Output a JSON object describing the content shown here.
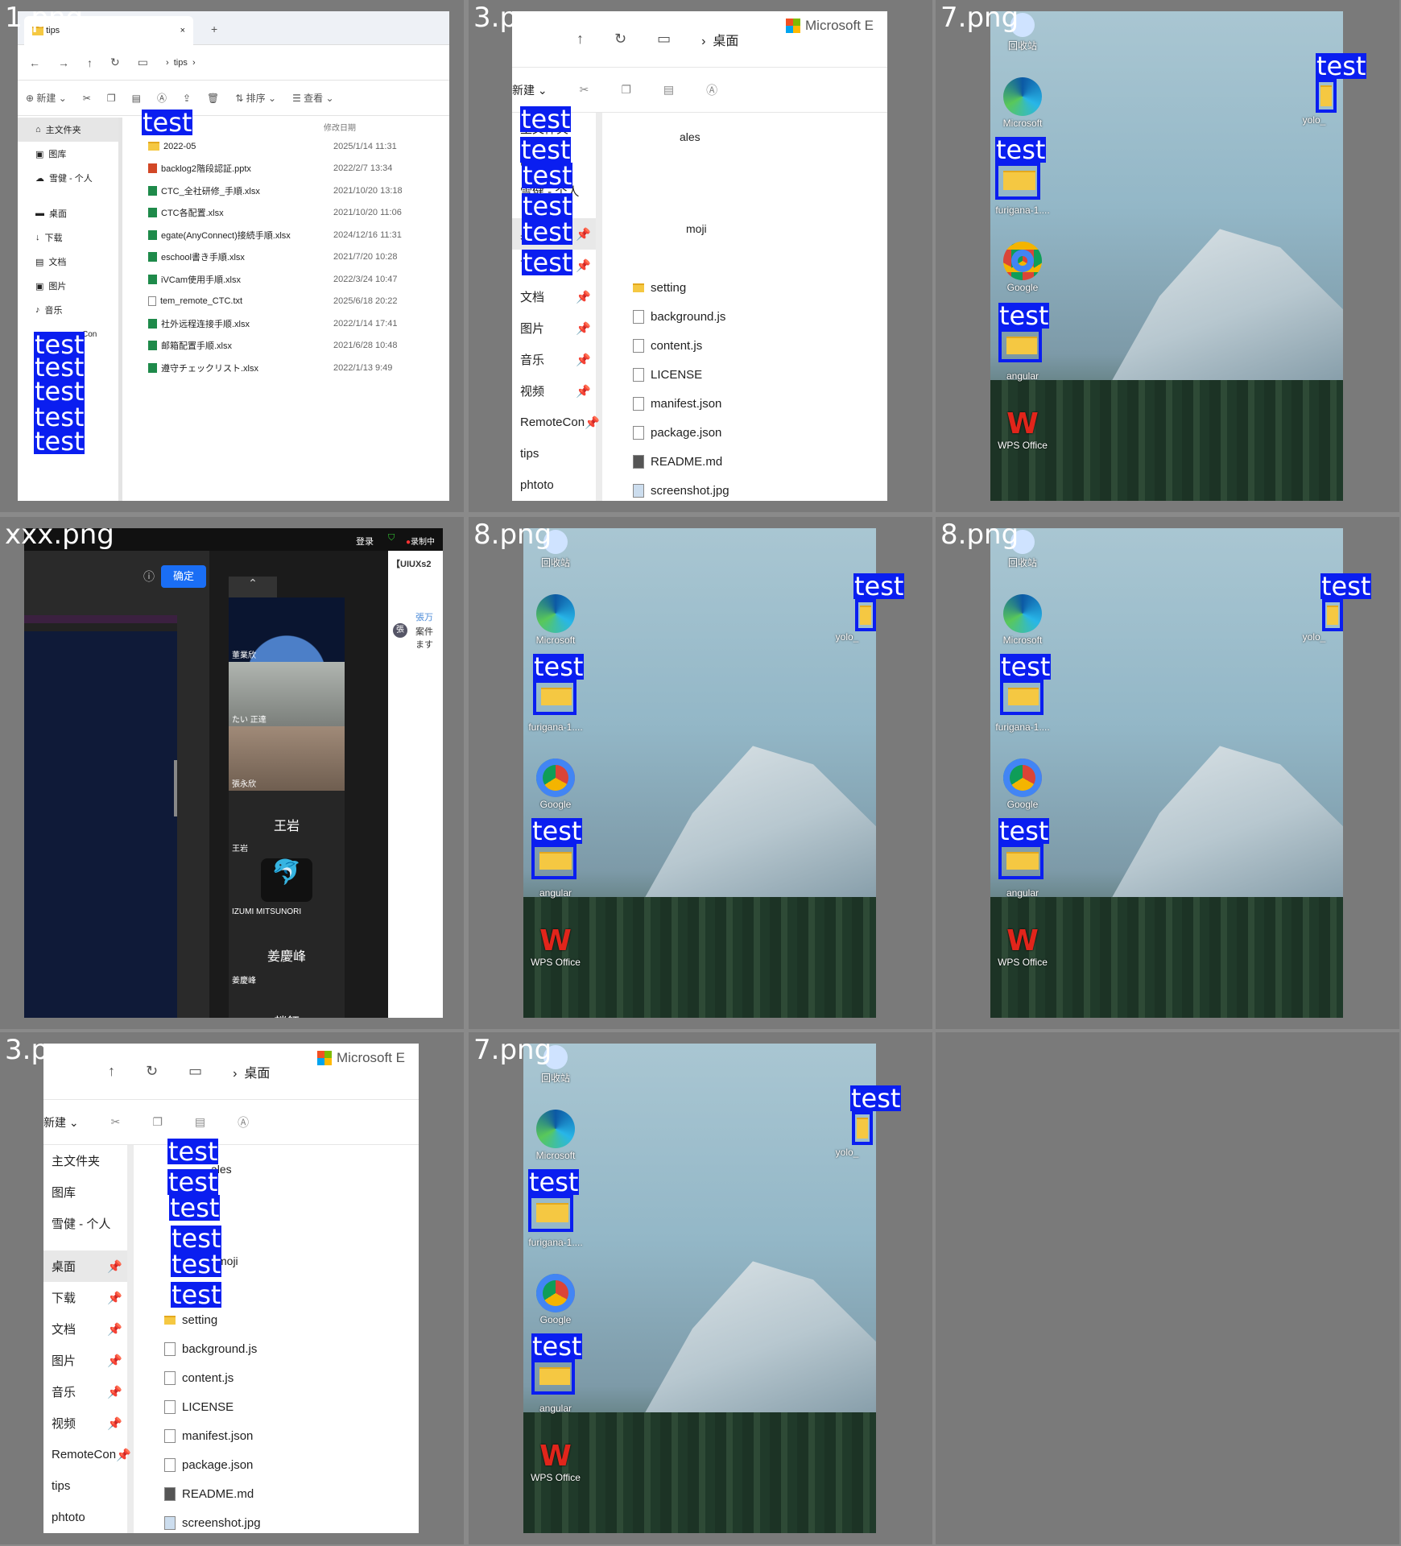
{
  "tiles": {
    "t1": {
      "label": "1.png"
    },
    "t2": {
      "label": "3.png"
    },
    "t3": {
      "label": "7.png"
    },
    "t4": {
      "label": "xxx.png"
    },
    "t5": {
      "label": "8.png"
    },
    "t6": {
      "label": "8.png"
    },
    "t7": {
      "label": "3.png"
    },
    "t8": {
      "label": "7.png"
    }
  },
  "det": {
    "text": "test"
  },
  "explorer1": {
    "tab": "tips",
    "path": "tips",
    "cmd_new": "新建",
    "cmd_sort": "排序",
    "cmd_view": "查看",
    "col_date": "修改日期",
    "side": [
      "主文件夹",
      "图库",
      "雪健 - 个人",
      "桌面",
      "下载",
      "文档",
      "图片",
      "音乐"
    ],
    "side_partial": "Con",
    "side_last": "val",
    "files": [
      {
        "name": "2022-05",
        "date": "2025/1/14 11:31"
      },
      {
        "name": "backlog2階段認証.pptx",
        "date": "2022/2/7 13:34"
      },
      {
        "name": "CTC_全社研修_手順.xlsx",
        "date": "2021/10/20 13:18"
      },
      {
        "name": "CTC各配置.xlsx",
        "date": "2021/10/20 11:06"
      },
      {
        "name": "egate(AnyConnect)接続手順.xlsx",
        "date": "2024/12/16 11:31"
      },
      {
        "name": "eschool書き手順.xlsx",
        "date": "2021/7/20 10:28"
      },
      {
        "name": "iVCam使用手順.xlsx",
        "date": "2022/3/24 10:47"
      },
      {
        "name": "tem_remote_CTC.txt",
        "date": "2025/6/18 20:22"
      },
      {
        "name": "社外远程连接手顺.xlsx",
        "date": "2022/1/14 17:41"
      },
      {
        "name": "邮箱配置手顺.xlsx",
        "date": "2021/6/28 10:48"
      },
      {
        "name": "遵守チェックリスト.xlsx",
        "date": "2022/1/13 9:49"
      }
    ]
  },
  "explorer3": {
    "path": "桌面",
    "ms": "Microsoft E",
    "cmd_new": "新建",
    "side": [
      "主文件夹",
      "图库",
      "雪健 - 个人",
      "桌面",
      "下载",
      "文档",
      "图片",
      "音乐",
      "视频",
      "RemoteCon",
      "tips",
      "phtoto"
    ],
    "partials": [
      "ales",
      "s",
      "moji"
    ],
    "files": [
      "setting",
      "background.js",
      "content.js",
      "LICENSE",
      "manifest.json",
      "package.json",
      "README.md",
      "screenshot.jpg"
    ]
  },
  "desktop": {
    "recycle": "回收站",
    "edge": "Microsoft",
    "furigana": "furigana-1....",
    "chrome": "Google",
    "angular": "angular",
    "wps": "WPS Office",
    "yolo": "yolo_"
  },
  "meeting": {
    "login": "登录",
    "rec": "录制中",
    "confirm": "确定",
    "side_title": "【UIUXs2",
    "chat_name": "張万",
    "chat_line1": "案件",
    "chat_line2": "ます",
    "avatar": "張",
    "participants": [
      "董業欣",
      "たい 正達",
      "張永欣",
      "王岩",
      "IZUMI MITSUNORI",
      "姜慶峰",
      "趙鈺"
    ],
    "names_big": [
      "王岩",
      "姜慶峰",
      "趙鈺"
    ],
    "small_names": [
      "王岩",
      "姜慶峰"
    ]
  }
}
